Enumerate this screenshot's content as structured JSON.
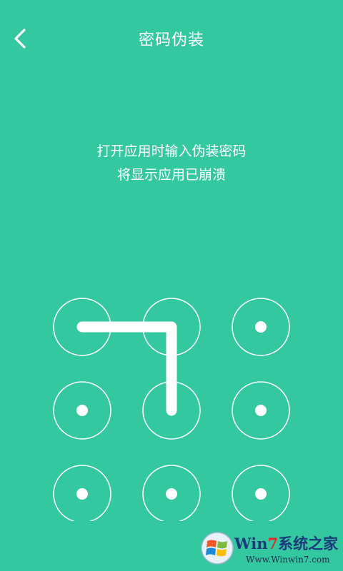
{
  "header": {
    "back_icon": "chevron-left-icon",
    "title": "密码伪装"
  },
  "hint": {
    "line1": "打开应用时输入伪装密码",
    "line2": "将显示应用已崩溃"
  },
  "pattern": {
    "grid": "3x3",
    "dot_ids": [
      "1",
      "2",
      "3",
      "4",
      "5",
      "6",
      "7",
      "8",
      "9"
    ],
    "selected_sequence": [
      "1",
      "2",
      "5"
    ]
  },
  "watermark": {
    "brand_prefix": "Win",
    "brand_seven": "7",
    "brand_suffix": "系统之家",
    "url": "Www.Winwin7.com"
  },
  "colors": {
    "background": "#33c8a0",
    "foreground": "#ffffff"
  }
}
